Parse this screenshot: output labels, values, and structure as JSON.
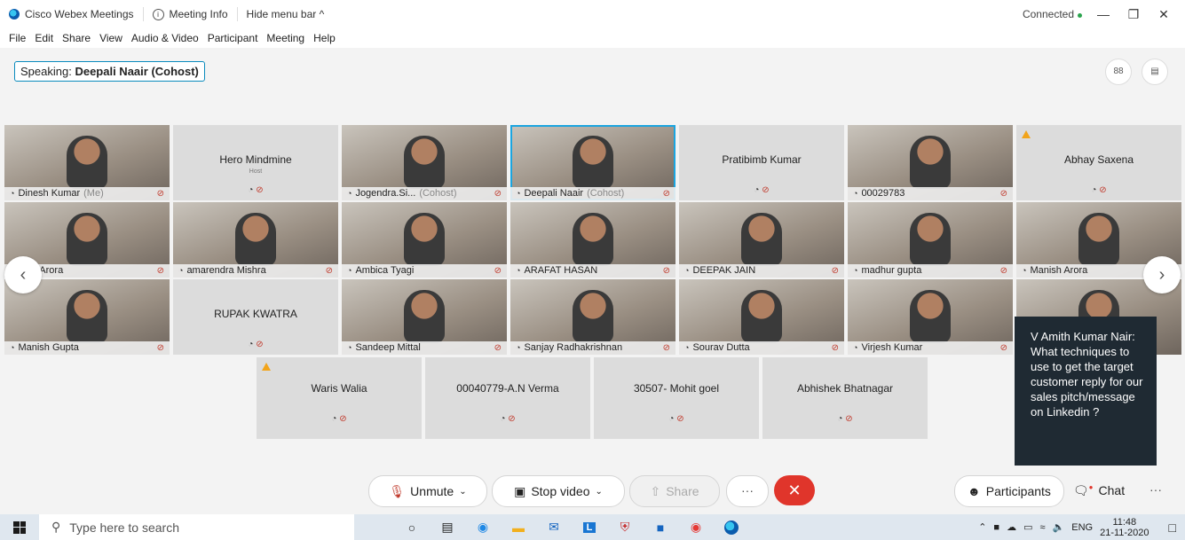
{
  "titlebar": {
    "app_name": "Cisco Webex Meetings",
    "meeting_info": "Meeting Info",
    "hide_menu": "Hide menu bar ^",
    "status": "Connected",
    "minimize": "—",
    "maximize": "❐",
    "close": "✕"
  },
  "menu": [
    "File",
    "Edit",
    "Share",
    "View",
    "Audio & Video",
    "Participant",
    "Meeting",
    "Help"
  ],
  "speaking": {
    "prefix": "Speaking:",
    "name": "Deepali Naair (Cohost)"
  },
  "participants": [
    {
      "name": "Dinesh Kumar",
      "tag": "(Me)",
      "video": true
    },
    {
      "name": "Hero Mindmine",
      "sub": "Host",
      "video": false
    },
    {
      "name": "Jogendra.Si...",
      "tag": "(Cohost)",
      "video": true
    },
    {
      "name": "Deepali Naair",
      "tag": "(Cohost)",
      "video": true,
      "speaker": true
    },
    {
      "name": "Pratibimb Kumar",
      "video": false
    },
    {
      "name": "00029783",
      "video": true
    },
    {
      "name": "Abhay Saxena",
      "video": false,
      "warn": true
    },
    {
      "name": "Ajay Arora",
      "video": true
    },
    {
      "name": "amarendra Mishra",
      "video": true
    },
    {
      "name": "Ambica Tyagi",
      "video": true
    },
    {
      "name": "ARAFAT HASAN",
      "video": true
    },
    {
      "name": "DEEPAK JAIN",
      "video": true
    },
    {
      "name": "madhur gupta",
      "video": true
    },
    {
      "name": "Manish Arora",
      "video": true
    },
    {
      "name": "Manish Gupta",
      "video": true
    },
    {
      "name": "RUPAK KWATRA",
      "video": false
    },
    {
      "name": "Sandeep Mittal",
      "video": true
    },
    {
      "name": "Sanjay Radhakrishnan",
      "video": true
    },
    {
      "name": "Sourav Dutta",
      "video": true
    },
    {
      "name": "Virjesh Kumar",
      "video": true
    },
    {
      "name": "",
      "video": true
    },
    {
      "name": "Waris Walia",
      "video": false,
      "warn": true
    },
    {
      "name": "00040779-A.N Verma",
      "video": false
    },
    {
      "name": "30507- Mohit goel",
      "video": false
    },
    {
      "name": "Abhishek Bhatnagar",
      "video": false
    }
  ],
  "chat_popup": "V Amith Kumar Nair: What techniques to use to get the target customer reply for our sales pitch/message on Linkedin ?",
  "controls": {
    "unmute": "Unmute",
    "stop_video": "Stop video",
    "share": "Share",
    "more": "···",
    "end": "✕",
    "participants": "Participants",
    "chat": "Chat"
  },
  "taskbar": {
    "search_placeholder": "Type here to search",
    "lang": "ENG",
    "time": "11:48",
    "date": "21-11-2020"
  }
}
